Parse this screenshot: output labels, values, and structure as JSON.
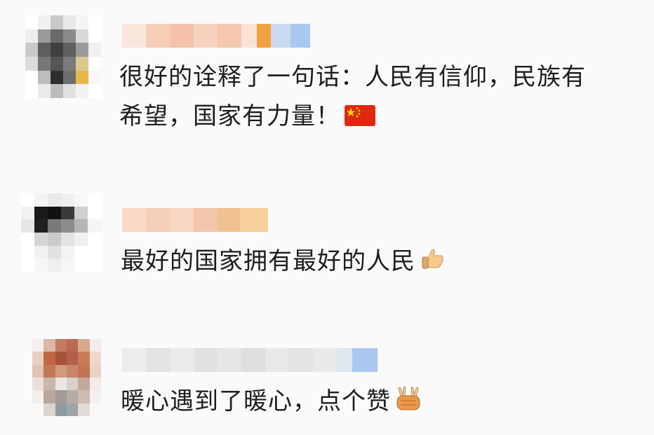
{
  "comments": [
    {
      "text_lines": [
        "很好的诠释了一句话：人民有信仰，民族有",
        "希望，国家有力量！"
      ],
      "emoji": "china-flag-icon"
    },
    {
      "text_lines": [
        "最好的国家拥有最好的人民"
      ],
      "emoji": "thumbs-up-icon"
    },
    {
      "text_lines": [
        "暖心遇到了暖心，点个赞"
      ],
      "emoji": "victory-hands-icon"
    }
  ],
  "colors": {
    "background": "#fafafa",
    "text": "#1e1e1e",
    "flag_red": "#de2910",
    "flag_yellow": "#ffde00"
  }
}
